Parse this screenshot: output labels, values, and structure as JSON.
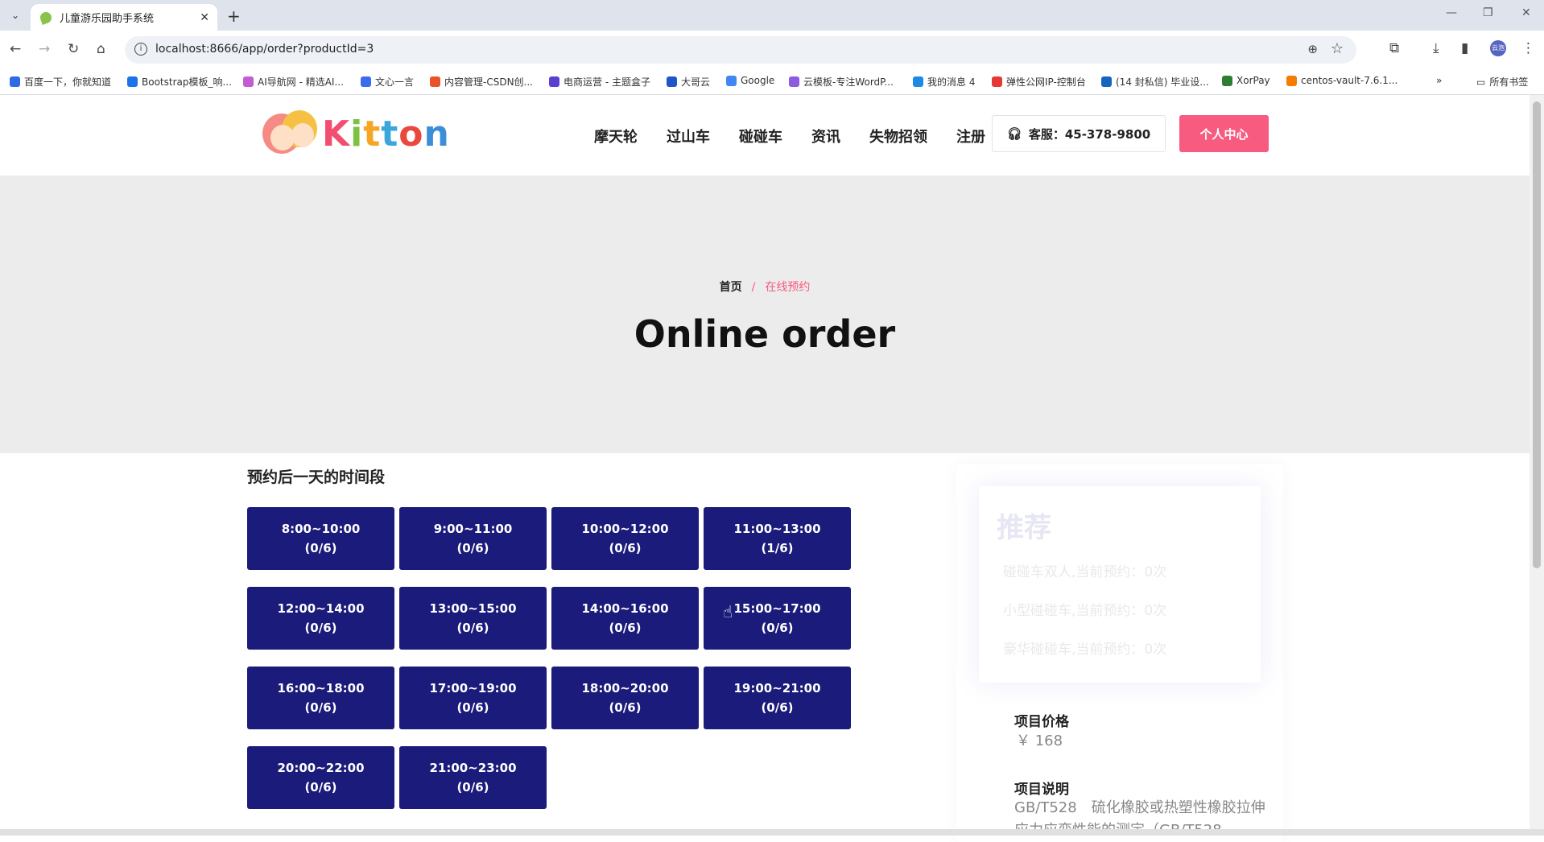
{
  "browser": {
    "tab_title": "儿童游乐园助手系统",
    "url": "localhost:8666/app/order?productId=3",
    "bookmarks": [
      {
        "label": "百度一下，你就知道",
        "color": "#2f6ae4"
      },
      {
        "label": "Bootstrap模板_响...",
        "color": "#1a73e8"
      },
      {
        "label": "AI导航网 - 精选AI...",
        "color": "#c35bd4"
      },
      {
        "label": "文心一言",
        "color": "#3b6cf0"
      },
      {
        "label": "内容管理-CSDN创...",
        "color": "#e8532a"
      },
      {
        "label": "电商运营 - 主题盒子",
        "color": "#5a3fd1"
      },
      {
        "label": "大哥云",
        "color": "#2055c8"
      },
      {
        "label": "Google",
        "color": "#4285f4"
      },
      {
        "label": "云模板-专注WordP...",
        "color": "#8c5be0"
      },
      {
        "label": "我的消息 4",
        "color": "#1e88e5"
      },
      {
        "label": "弹性公网IP-控制台",
        "color": "#e53935"
      },
      {
        "label": "(14 封私信) 毕业设...",
        "color": "#1565c0"
      },
      {
        "label": "XorPay",
        "color": "#2e7d32"
      },
      {
        "label": "centos-vault-7.6.1...",
        "color": "#f57c00"
      }
    ],
    "all_bookmarks": "所有书签",
    "profile_label": "云泡"
  },
  "site": {
    "logo_text": "Kitton",
    "nav": [
      "摩天轮",
      "过山车",
      "碰碰车",
      "资讯",
      "失物招领",
      "注册"
    ],
    "service_label": "客服：45-378-9800",
    "personal_center": "个人中心"
  },
  "hero": {
    "breadcrumb_home": "首页",
    "breadcrumb_sep": "/",
    "breadcrumb_current": "在线预约",
    "title": "Online order"
  },
  "booking": {
    "section_title": "预约后一天的时间段",
    "slots": [
      {
        "time": "8:00~10:00",
        "count": "(0/6)"
      },
      {
        "time": "9:00~11:00",
        "count": "(0/6)"
      },
      {
        "time": "10:00~12:00",
        "count": "(0/6)"
      },
      {
        "time": "11:00~13:00",
        "count": "(1/6)"
      },
      {
        "time": "12:00~14:00",
        "count": "(0/6)"
      },
      {
        "time": "13:00~15:00",
        "count": "(0/6)"
      },
      {
        "time": "14:00~16:00",
        "count": "(0/6)"
      },
      {
        "time": "15:00~17:00",
        "count": "(0/6)"
      },
      {
        "time": "16:00~18:00",
        "count": "(0/6)"
      },
      {
        "time": "17:00~19:00",
        "count": "(0/6)"
      },
      {
        "time": "18:00~20:00",
        "count": "(0/6)"
      },
      {
        "time": "19:00~21:00",
        "count": "(0/6)"
      },
      {
        "time": "20:00~22:00",
        "count": "(0/6)"
      },
      {
        "time": "21:00~23:00",
        "count": "(0/6)"
      }
    ]
  },
  "sidebar": {
    "recommend_title": "推荐",
    "recommend_items": [
      "碰碰车双人,当前预约：0次",
      "小型碰碰车,当前预约：0次",
      "豪华碰碰车,当前预约：0次"
    ],
    "price_label": "项目价格",
    "price_value": "￥ 168",
    "desc_label": "项目说明",
    "desc_text": "GB/T528　硫化橡胶或热塑性橡胶拉伸应力应变性能的测定（GB/T528"
  },
  "colors": {
    "slot_bg": "#1a1b7a",
    "accent": "#f75b7f",
    "hero_bg": "#ececec"
  }
}
